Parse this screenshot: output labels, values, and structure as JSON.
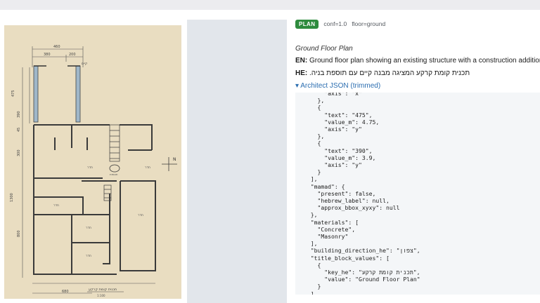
{
  "plan_image": {
    "dimension_labels": [
      "460",
      "380",
      "200",
      "475",
      "390",
      "45",
      "300",
      "1300",
      "800",
      "680"
    ],
    "room_labels": [
      "חדר",
      "חדר",
      "חדר",
      "חדר",
      "חדר",
      "חדר"
    ],
    "drawing_labels": [
      "קיים",
      "תוספת",
      "1:100",
      "N"
    ],
    "title_block": "תכנית קומת קרקע"
  },
  "meta": {
    "badge": "PLAN",
    "confidence": "conf=1.0",
    "floor": "floor=ground"
  },
  "title": "Ground Floor Plan",
  "description_en": {
    "label": "EN:",
    "text": "Ground floor plan showing an existing structure with a construction addition."
  },
  "description_he": {
    "label": "HE:",
    "text": "תכנית קומת קרקע המציגה מבנה קיים עם תוספת בניה."
  },
  "json_toggle": {
    "label": "▾ Architect JSON (trimmed)"
  },
  "json_text": "      \"axis\": \"x\"\n    },\n    {\n      \"text\": \"475\",\n      \"value_m\": 4.75,\n      \"axis\": \"y\"\n    },\n    {\n      \"text\": \"390\",\n      \"value_m\": 3.9,\n      \"axis\": \"y\"\n    }\n  ],\n  \"mamad\": {\n    \"present\": false,\n    \"hebrew_label\": null,\n    \"approx_bbox_xyxy\": null\n  },\n  \"materials\": [\n    \"Concrete\",\n    \"Masonry\"\n  ],\n  \"building_direction_he\": \"צפון\",\n  \"title_block_values\": [\n    {\n      \"key_he\": \"תכנית קומת קרקע\",\n      \"value\": \"Ground Floor Plan\"\n    }\n  ],\n  \"site_plan_notes\": {\n    \"plot_boundary\": false"
}
